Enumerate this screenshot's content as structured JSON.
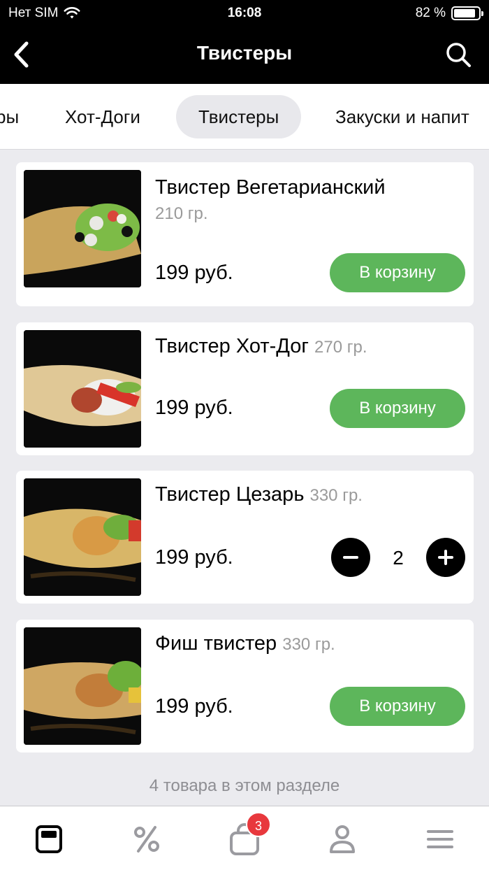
{
  "status_bar": {
    "carrier": "Нет SIM",
    "time": "16:08",
    "battery": "82 %"
  },
  "nav": {
    "title": "Твистеры",
    "back_icon": "chevron-left-icon",
    "search_icon": "search-icon"
  },
  "categories": [
    {
      "label": "ры"
    },
    {
      "label": "Хот-Доги"
    },
    {
      "label": "Твистеры",
      "active": true
    },
    {
      "label": "Закуски и напит"
    }
  ],
  "products": [
    {
      "name": "Твистер Вегетарианский",
      "weight": "210 гр.",
      "price": "199 руб.",
      "button": "В корзину"
    },
    {
      "name": "Твистер Хот-Дог",
      "weight": "270 гр.",
      "price": "199 руб.",
      "button": "В корзину"
    },
    {
      "name": "Твистер Цезарь",
      "weight": "330 гр.",
      "price": "199 руб.",
      "quantity": "2"
    },
    {
      "name": "Фиш твистер",
      "weight": "330 гр.",
      "price": "199 руб.",
      "button": "В корзину"
    }
  ],
  "section_count": "4 товара в этом разделе",
  "tabbar": {
    "items": [
      "menu-icon",
      "percent-icon",
      "bag-icon",
      "profile-icon",
      "hamburger-icon"
    ],
    "cart_badge": "3"
  },
  "colors": {
    "accent_green": "#5db65b",
    "badge_red": "#e8383d"
  }
}
